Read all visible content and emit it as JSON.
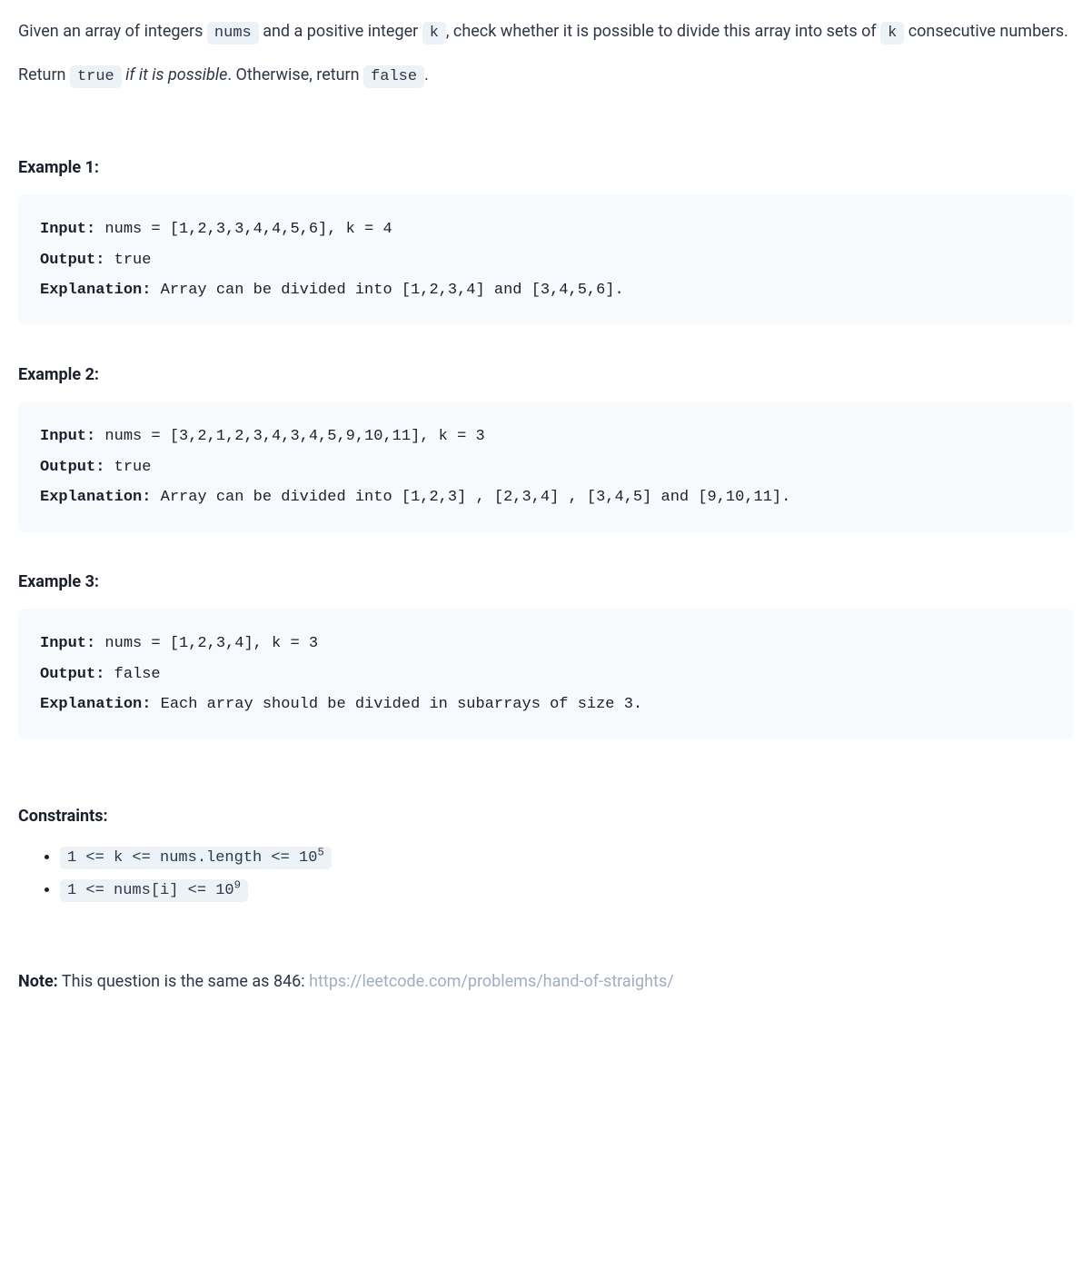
{
  "intro": {
    "part1": "Given an array of integers ",
    "code1": "nums",
    "part2": " and a positive integer ",
    "code2": "k",
    "part3": ", check whether it is possible to divide this array into sets of ",
    "code3": "k",
    "part4": " consecutive numbers."
  },
  "return_line": {
    "part1": "Return ",
    "code1": "true",
    "italic": " if it is possible",
    "part2": ". Otherwise, return ",
    "code2": "false",
    "part3": "."
  },
  "examples": [
    {
      "title": "Example 1:",
      "input_label": "Input:",
      "input_value": " nums = [1,2,3,3,4,4,5,6], k = 4",
      "output_label": "Output:",
      "output_value": " true",
      "explanation_label": "Explanation:",
      "explanation_value": " Array can be divided into [1,2,3,4] and [3,4,5,6]."
    },
    {
      "title": "Example 2:",
      "input_label": "Input:",
      "input_value": " nums = [3,2,1,2,3,4,3,4,5,9,10,11], k = 3",
      "output_label": "Output:",
      "output_value": " true",
      "explanation_label": "Explanation:",
      "explanation_value": " Array can be divided into [1,2,3] , [2,3,4] , [3,4,5] and [9,10,11]."
    },
    {
      "title": "Example 3:",
      "input_label": "Input:",
      "input_value": " nums = [1,2,3,4], k = 3",
      "output_label": "Output:",
      "output_value": " false",
      "explanation_label": "Explanation:",
      "explanation_value": " Each array should be divided in subarrays of size 3."
    }
  ],
  "constraints": {
    "title": "Constraints:",
    "items": [
      {
        "pre": "1 <= k <= nums.length <= 10",
        "sup": "5"
      },
      {
        "pre": "1 <= nums[i] <= 10",
        "sup": "9"
      }
    ]
  },
  "note": {
    "label": "Note:",
    "text": " This question is the same as 846: ",
    "link": "https://leetcode.com/problems/hand-of-straights/"
  }
}
